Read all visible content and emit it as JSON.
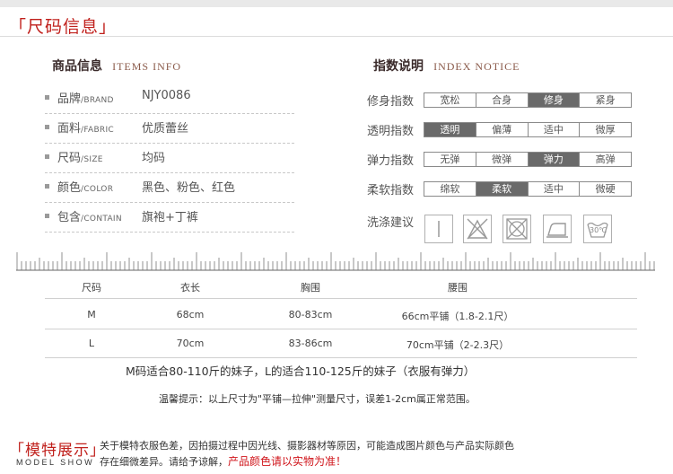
{
  "header": {
    "title": "「尺码信息」"
  },
  "product_info": {
    "title_cn": "商品信息",
    "title_en": "ITEMS INFO",
    "rows": [
      {
        "label": "品牌",
        "label_en": "/BRAND",
        "value": "NJY0086"
      },
      {
        "label": "面料",
        "label_en": "/FABRIC",
        "value": "优质蕾丝"
      },
      {
        "label": "尺码",
        "label_en": "/SIZE",
        "value": "均码"
      },
      {
        "label": "颜色",
        "label_en": "/COLOR",
        "value": "黑色、粉色、红色"
      },
      {
        "label": "包含",
        "label_en": "/CONTAIN",
        "value": "旗袍+丁裤"
      }
    ]
  },
  "index_notice": {
    "title_cn": "指数说明",
    "title_en": "INDEX NOTICE",
    "rows": [
      {
        "label": "修身指数",
        "options": [
          "宽松",
          "合身",
          "修身",
          "紧身"
        ],
        "selected": 2
      },
      {
        "label": "透明指数",
        "options": [
          "透明",
          "偏薄",
          "适中",
          "微厚"
        ],
        "selected": 0
      },
      {
        "label": "弹力指数",
        "options": [
          "无弹",
          "微弹",
          "弹力",
          "高弹"
        ],
        "selected": 2
      },
      {
        "label": "柔软指数",
        "options": [
          "绵软",
          "柔软",
          "适中",
          "微硬"
        ],
        "selected": 1
      }
    ],
    "care_label": "洗涤建议",
    "care_icons": [
      "hang-dry-icon",
      "no-bleach-icon",
      "no-tumble-dry-icon",
      "iron-low-icon",
      "hand-wash-30-icon"
    ],
    "wash_temp": "30℃"
  },
  "size_table": {
    "headers": [
      "尺码",
      "衣长",
      "胸围",
      "腰围"
    ],
    "rows": [
      [
        "M",
        "68cm",
        "80-83cm",
        "66cm平铺（1.8-2.1尺）"
      ],
      [
        "L",
        "70cm",
        "83-86cm",
        "70cm平铺（2-2.3尺）"
      ]
    ],
    "fit_note": "M码适合80-110斤的妹子，L的适合110-125斤的妹子（衣服有弹力）",
    "tip": "温馨提示：以上尺寸为\"平铺—拉伸\"测量尺寸，误差1-2cm属正常范围。"
  },
  "model_show": {
    "title": "「模特展示」",
    "title_en": "MODEL SHOW",
    "line1": "关于模特衣服色差，因拍摄过程中因光线、摄影器材等原因，可能造成图片颜色与产品实际颜色",
    "line2_prefix": "存在细微差异。请给予谅解，",
    "line2_highlight": "产品颜色请以实物为准！"
  },
  "colors": {
    "accent_red": "#c0201c",
    "selected_fill": "#6a6a6a"
  }
}
